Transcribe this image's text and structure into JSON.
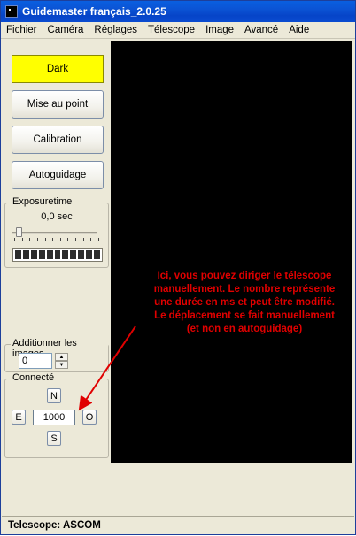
{
  "window": {
    "title": "Guidemaster français_2.0.25"
  },
  "menu": {
    "items": [
      "Fichier",
      "Caméra",
      "Réglages",
      "Télescope",
      "Image",
      "Avancé",
      "Aide"
    ]
  },
  "buttons": {
    "dark": "Dark",
    "focus": "Mise au point",
    "calibration": "Calibration",
    "autoguide": "Autoguidage"
  },
  "colors": {
    "dark_button": "#ffff00",
    "annotation": "#e00000",
    "display": "#000000"
  },
  "exposure": {
    "label": "Exposuretime",
    "value": "0,0 sec",
    "slider_fraction": 0.0
  },
  "add_images": {
    "label": "Additionner les images",
    "value": "0"
  },
  "connect": {
    "label": "Connecté",
    "north": "N",
    "south": "S",
    "east": "E",
    "west": "O",
    "step_ms": "1000"
  },
  "annotation": {
    "text": "Ici, vous pouvez diriger le télescope manuellement. Le nombre représente une durée en ms et peut être modifié. Le déplacement se fait manuellement (et non en autoguidage)"
  },
  "status": {
    "text": "Telescope: ASCOM"
  }
}
